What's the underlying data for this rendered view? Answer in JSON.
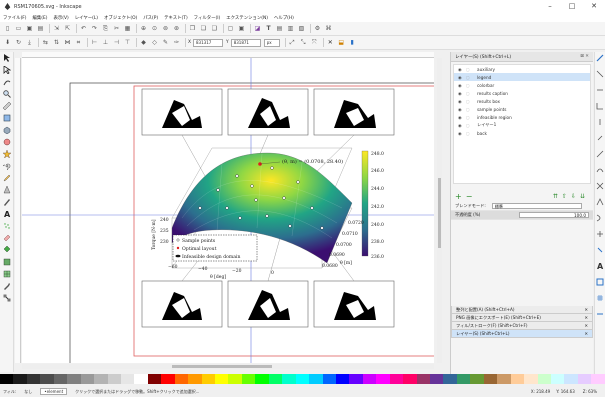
{
  "window": {
    "title": "RSM170605.svg - Inkscape",
    "controls": [
      "–",
      "□",
      "✕"
    ]
  },
  "menu": [
    "ファイル(F)",
    "編集(E)",
    "表示(V)",
    "レイヤー(L)",
    "オブジェクト(O)",
    "パス(P)",
    "テキスト(T)",
    "フィルター(I)",
    "エクステンション(N)",
    "ヘルプ(H)"
  ],
  "toolbar": {
    "x_value": "831317",
    "y_value": "831871",
    "unit": "px"
  },
  "figure": {
    "annotation": "(θ, m) = (0.0708, 28.40)",
    "colorbar_ticks": [
      "248.0",
      "246.0",
      "244.0",
      "242.0",
      "240.0",
      "238.0",
      "236.0"
    ],
    "y_axis_label": "Torque [N·m]",
    "y_ticks": [
      "240",
      "235",
      "230"
    ],
    "theta_ticks": [
      "−60",
      "−40",
      "−20",
      "0"
    ],
    "theta_label": "θ [deg]",
    "m_ticks": [
      "0.0720",
      "0.0710",
      "0.0700",
      "0.0690",
      "0.0680"
    ],
    "m_label": "θ [m]",
    "legend": [
      "Sample points",
      "Optimal layout",
      "Infeasible design domain"
    ]
  },
  "layers_panel": {
    "tab_title": "レイヤー(S) (Shift+Ctrl+L)",
    "layers": [
      {
        "name": "auxiliary",
        "selected": false
      },
      {
        "name": "legend",
        "selected": true
      },
      {
        "name": "colorbar",
        "selected": false
      },
      {
        "name": "results caption",
        "selected": false
      },
      {
        "name": "results box",
        "selected": false
      },
      {
        "name": "sample points",
        "selected": false
      },
      {
        "name": "infeasible region",
        "selected": false
      },
      {
        "name": "レイヤー1",
        "selected": false
      },
      {
        "name": "back",
        "selected": false
      }
    ],
    "blend_label": "ブレンドモード:",
    "blend_value": "標準",
    "opacity_label": "不透明度 (%)",
    "opacity_value": "100.0"
  },
  "dock_tabs": [
    {
      "label": "整列と配置(A) (Shift+Ctrl+A)",
      "active": false
    },
    {
      "label": "PNG 画像にエクスポート(E) (Shift+Ctrl+E)",
      "active": false
    },
    {
      "label": "フィル/ストローク(F) (Shift+Ctrl+F)",
      "active": false
    },
    {
      "label": "レイヤー(S) (Shift+Ctrl+L)",
      "active": true
    }
  ],
  "status": {
    "fill_label": "フィル:",
    "stroke_label": "なし",
    "layer": "•element",
    "message": "クリックで選択またはドラッグで移動。Shift+クリックで追加選択...",
    "x": "X: 218.49",
    "y": "Y: 164.63",
    "zoom": "Z: 63%"
  },
  "palette": [
    "#000000",
    "#1a1a1a",
    "#333333",
    "#4d4d4d",
    "#666666",
    "#808080",
    "#999999",
    "#b3b3b3",
    "#cccccc",
    "#e6e6e6",
    "#ffffff",
    "#800000",
    "#ff0000",
    "#ff6600",
    "#ff9900",
    "#ffcc00",
    "#ffff00",
    "#ccff00",
    "#66ff00",
    "#00ff00",
    "#00ff66",
    "#00ffcc",
    "#00ffff",
    "#00ccff",
    "#0066ff",
    "#0000ff",
    "#6600ff",
    "#cc00ff",
    "#ff00ff",
    "#ff0099",
    "#ff0066",
    "#993366",
    "#663399",
    "#336699",
    "#339966",
    "#669933",
    "#996633",
    "#cc9966",
    "#ffcc99",
    "#ffe6cc",
    "#ccffcc",
    "#ccffff",
    "#cce6ff",
    "#e6ccff",
    "#ffccff"
  ]
}
